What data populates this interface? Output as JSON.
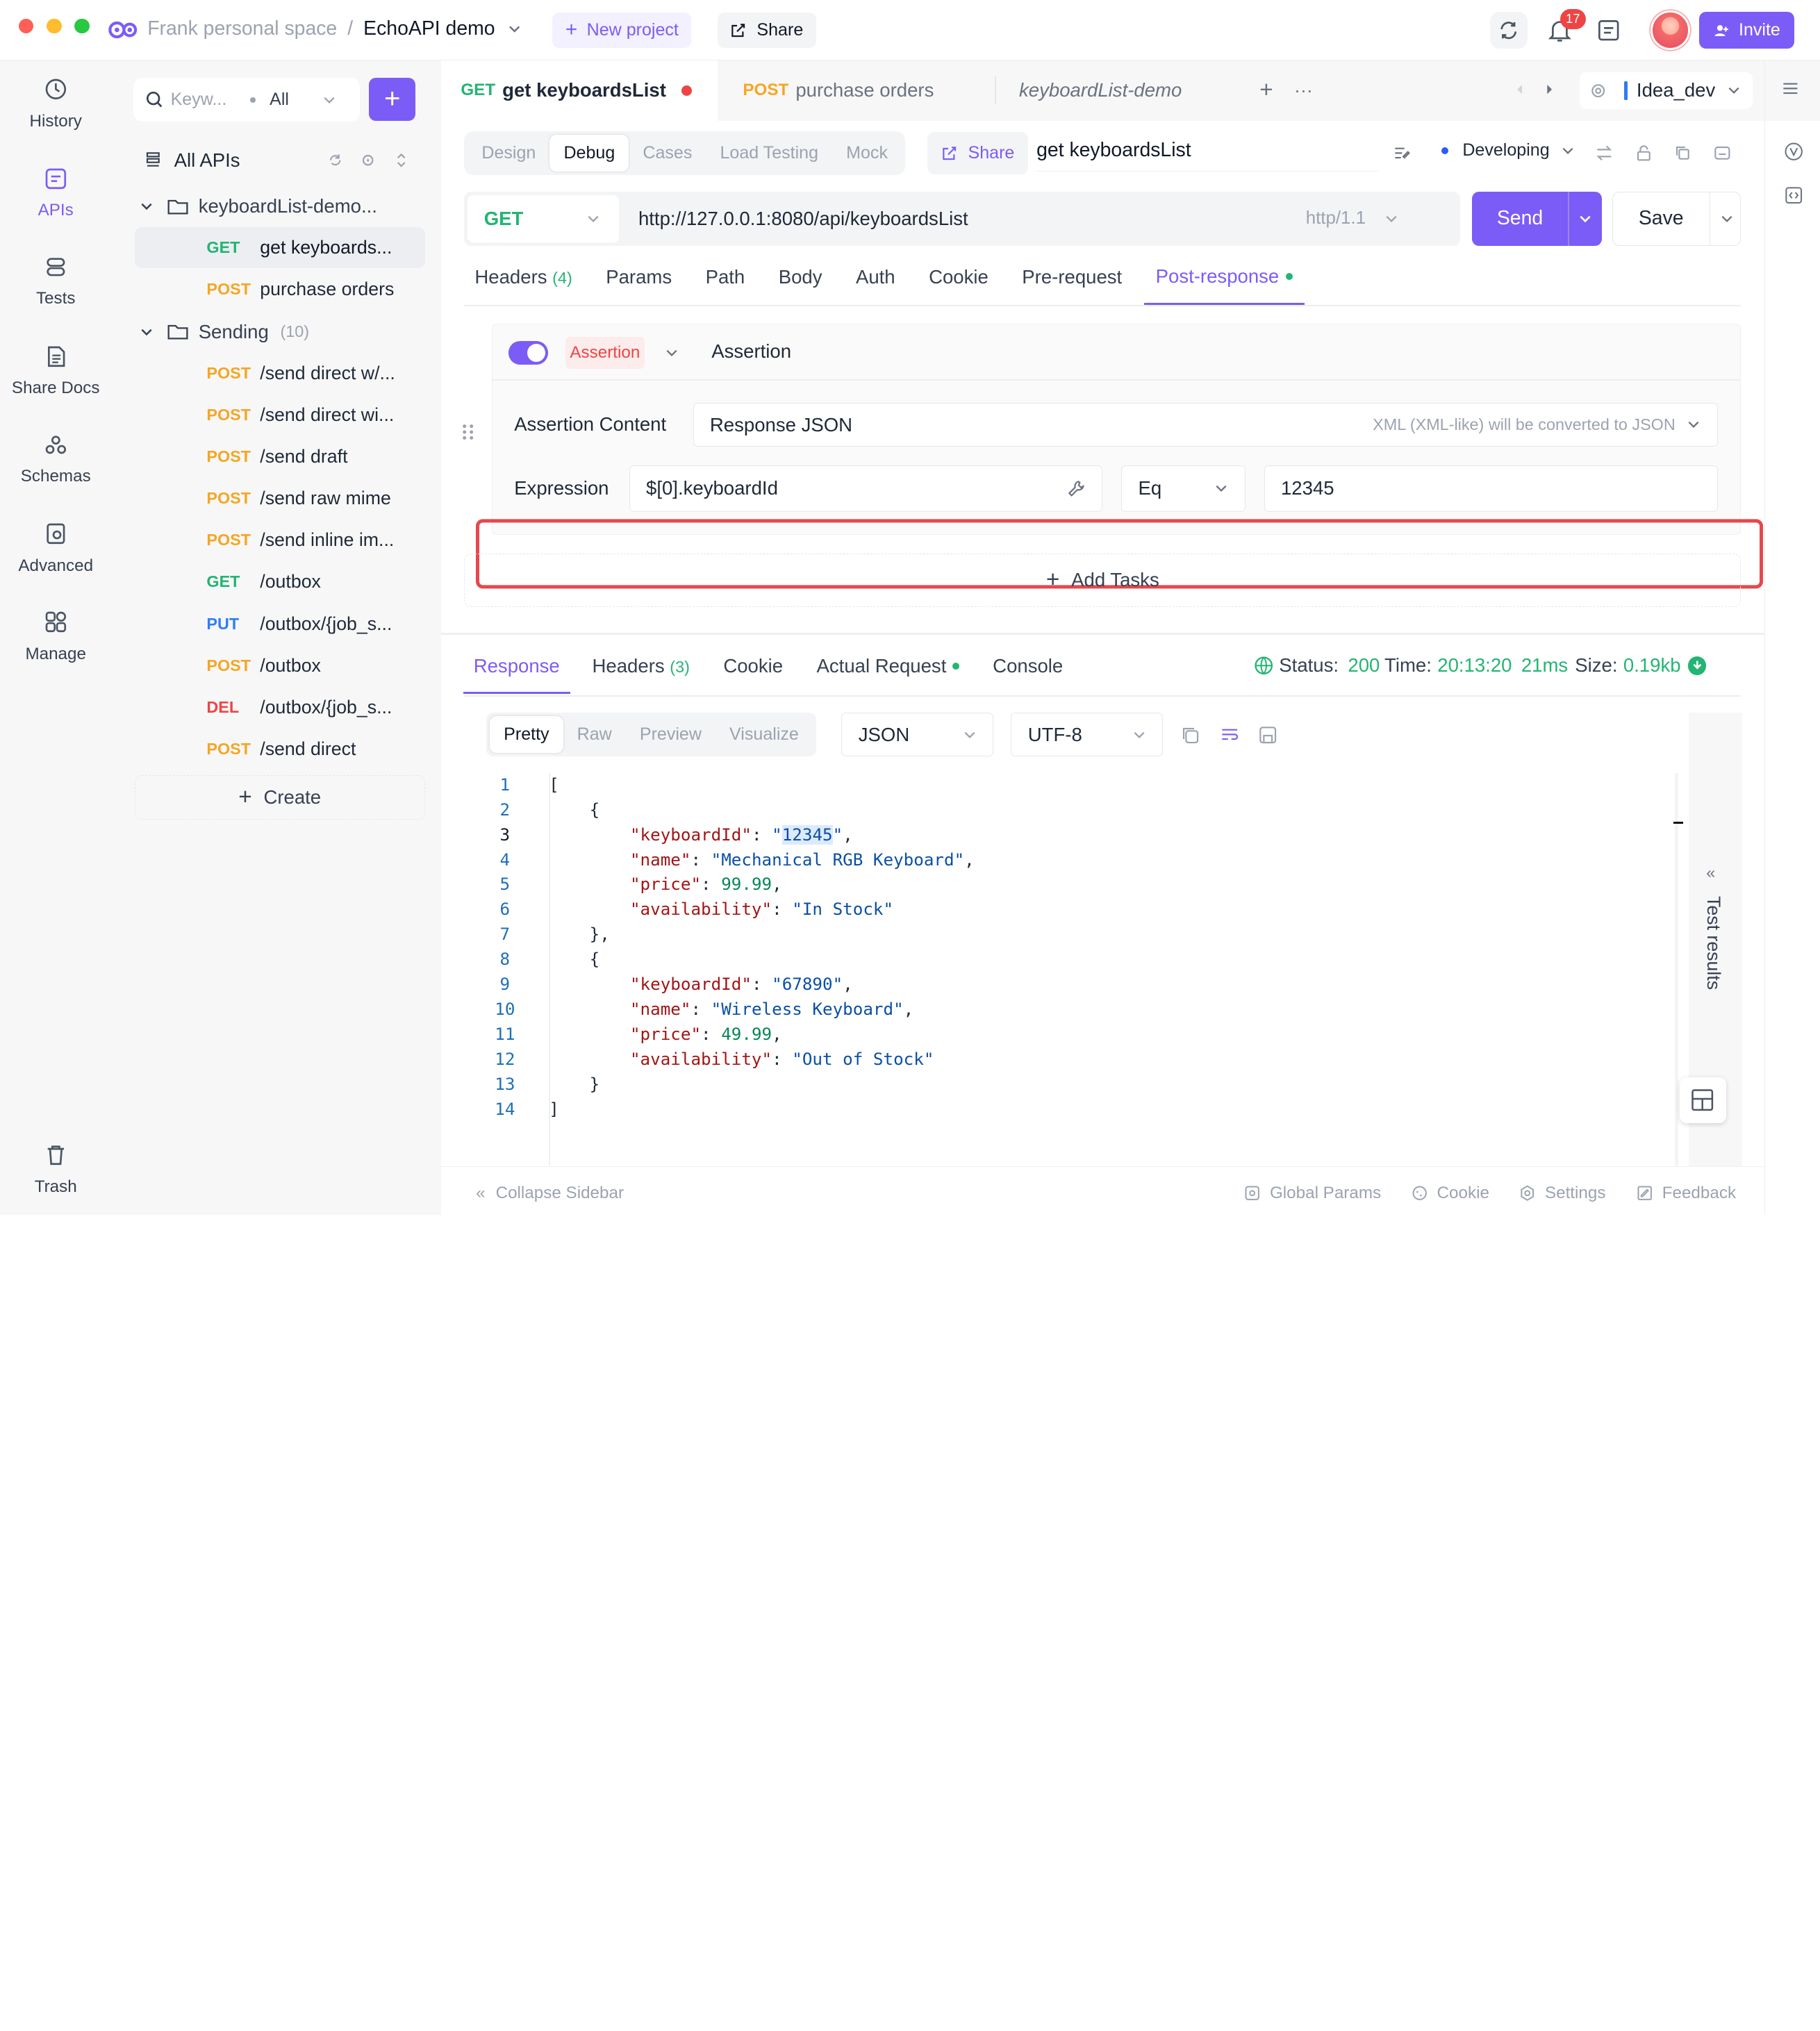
{
  "titlebar": {
    "workspace": "Frank personal space",
    "separator": "/",
    "project": "EchoAPI demo",
    "new_project": "New project",
    "share": "Share",
    "notification_count": "17",
    "invite": "Invite"
  },
  "nav": [
    {
      "label": "History",
      "icon": "history-icon"
    },
    {
      "label": "APIs",
      "icon": "apis-icon",
      "active": true
    },
    {
      "label": "Tests",
      "icon": "tests-icon"
    },
    {
      "label": "Share Docs",
      "icon": "share-docs-icon"
    },
    {
      "label": "Schemas",
      "icon": "schemas-icon"
    },
    {
      "label": "Advanced",
      "icon": "advanced-icon"
    },
    {
      "label": "Manage",
      "icon": "manage-icon"
    },
    {
      "label": "Trash",
      "icon": "trash-icon"
    }
  ],
  "sidebar": {
    "search_placeholder": "Keyw...",
    "filter": "All",
    "all_apis": "All APIs",
    "folder1": {
      "name": "keyboardList-demo...",
      "items": [
        {
          "method": "GET",
          "name": "get keyboards..."
        },
        {
          "method": "POST",
          "name": "purchase orders"
        }
      ]
    },
    "folder2": {
      "name": "Sending",
      "count": "(10)",
      "items": [
        {
          "method": "POST",
          "name": "/send direct w/..."
        },
        {
          "method": "POST",
          "name": "/send direct wi..."
        },
        {
          "method": "POST",
          "name": "/send draft"
        },
        {
          "method": "POST",
          "name": "/send raw mime"
        },
        {
          "method": "POST",
          "name": "/send inline im..."
        },
        {
          "method": "GET",
          "name": "/outbox"
        },
        {
          "method": "PUT",
          "name": "/outbox/{job_s..."
        },
        {
          "method": "POST",
          "name": "/outbox"
        },
        {
          "method": "DEL",
          "name": "/outbox/{job_s..."
        },
        {
          "method": "POST",
          "name": "/send direct"
        }
      ]
    },
    "create": "Create"
  },
  "tabs": {
    "tab1_method": "GET",
    "tab1_name": "get keyboardsList",
    "tab2_method": "POST",
    "tab2_name": "purchase orders",
    "tab3_name": "keyboardList-demo",
    "env": "Idea_dev"
  },
  "subtabs": [
    "Design",
    "Debug",
    "Cases",
    "Load Testing",
    "Mock"
  ],
  "request": {
    "share": "Share",
    "name": "get keyboardsList",
    "status": "Developing",
    "method": "GET",
    "url": "http://127.0.0.1:8080/api/keyboardsList",
    "protocol": "http/1.1",
    "send": "Send",
    "save": "Save"
  },
  "req_tabs": {
    "headers": "Headers",
    "headers_count": "(4)",
    "params": "Params",
    "path": "Path",
    "body": "Body",
    "auth": "Auth",
    "cookie": "Cookie",
    "pre": "Pre-request",
    "post": "Post-response"
  },
  "assertion": {
    "tag": "Assertion",
    "title": "Assertion",
    "content_label": "Assertion Content",
    "content_value": "Response JSON",
    "content_hint": "XML (XML-like) will be converted to JSON",
    "expr_label": "Expression",
    "expr_value": "$[0].keyboardId",
    "operator": "Eq",
    "expected": "12345",
    "add_tasks": "Add Tasks"
  },
  "response": {
    "tab_response": "Response",
    "tab_headers": "Headers",
    "headers_count": "(3)",
    "tab_cookie": "Cookie",
    "tab_actual": "Actual Request",
    "tab_console": "Console",
    "status_label": "Status:",
    "status_value": "200",
    "time_label": "Time:",
    "time_value": "20:13:20",
    "duration": "21ms",
    "size_label": "Size:",
    "size_value": "0.19kb",
    "view_modes": [
      "Pretty",
      "Raw",
      "Preview",
      "Visualize"
    ],
    "format": "JSON",
    "encoding": "UTF-8",
    "test_results": "Test results"
  },
  "code": [
    "[",
    "    {",
    "        \"keyboardId\": \"12345\",",
    "        \"name\": \"Mechanical RGB Keyboard\",",
    "        \"price\": 99.99,",
    "        \"availability\": \"In Stock\"",
    "    },",
    "    {",
    "        \"keyboardId\": \"67890\",",
    "        \"name\": \"Wireless Keyboard\",",
    "        \"price\": 49.99,",
    "        \"availability\": \"Out of Stock\"",
    "    }",
    "]"
  ],
  "footer": {
    "collapse": "Collapse Sidebar",
    "global_params": "Global Params",
    "cookie": "Cookie",
    "settings": "Settings",
    "feedback": "Feedback"
  },
  "colors": {
    "accent": "#7c5cf6",
    "get": "#22b573",
    "post": "#f5a623",
    "put": "#2f7df6",
    "delete": "#ef4444",
    "highlight_box": "#e5484d"
  }
}
